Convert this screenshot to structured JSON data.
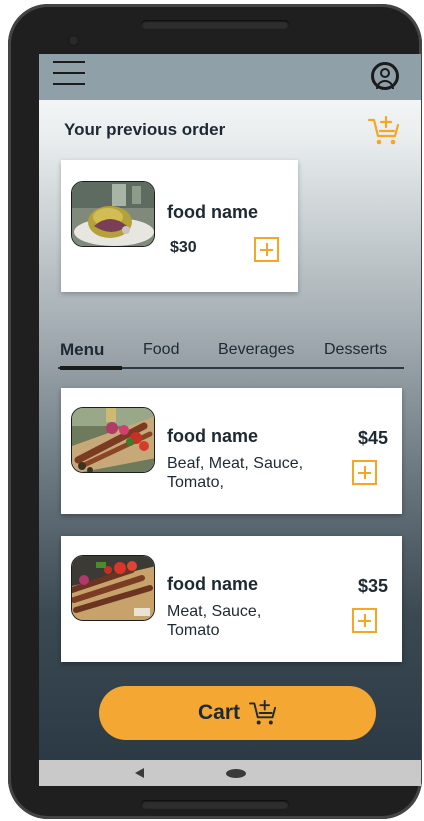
{
  "header": {
    "menu_icon": "menu-icon",
    "account_icon": "account-circle-icon"
  },
  "previous_order": {
    "title": "Your previous order",
    "cart_icon": "cart-plus-icon",
    "item": {
      "name": "food name",
      "price": "$30",
      "image": "stuffed-bread-dish-photo",
      "add_icon": "add-box-icon"
    }
  },
  "tabs": [
    {
      "label": "Menu",
      "active": true
    },
    {
      "label": "Food",
      "active": false
    },
    {
      "label": "Beverages",
      "active": false
    },
    {
      "label": "Desserts",
      "active": false
    }
  ],
  "menu_items": [
    {
      "name": "food name",
      "description": "Beaf, Meat, Sauce, Tomato,",
      "price": "$45",
      "image": "kebab-platter-photo",
      "add_icon": "add-box-icon"
    },
    {
      "name": "food name",
      "description": "Meat, Sauce, Tomato",
      "price": "$35",
      "image": "grilled-kebab-photo",
      "add_icon": "add-box-icon"
    }
  ],
  "cart": {
    "label": "Cart",
    "icon": "cart-plus-icon"
  },
  "colors": {
    "accent": "#f5a733",
    "appbar": "#8fa0a8",
    "text": "#1e2a33",
    "background_bottom": "#2c3a45"
  }
}
